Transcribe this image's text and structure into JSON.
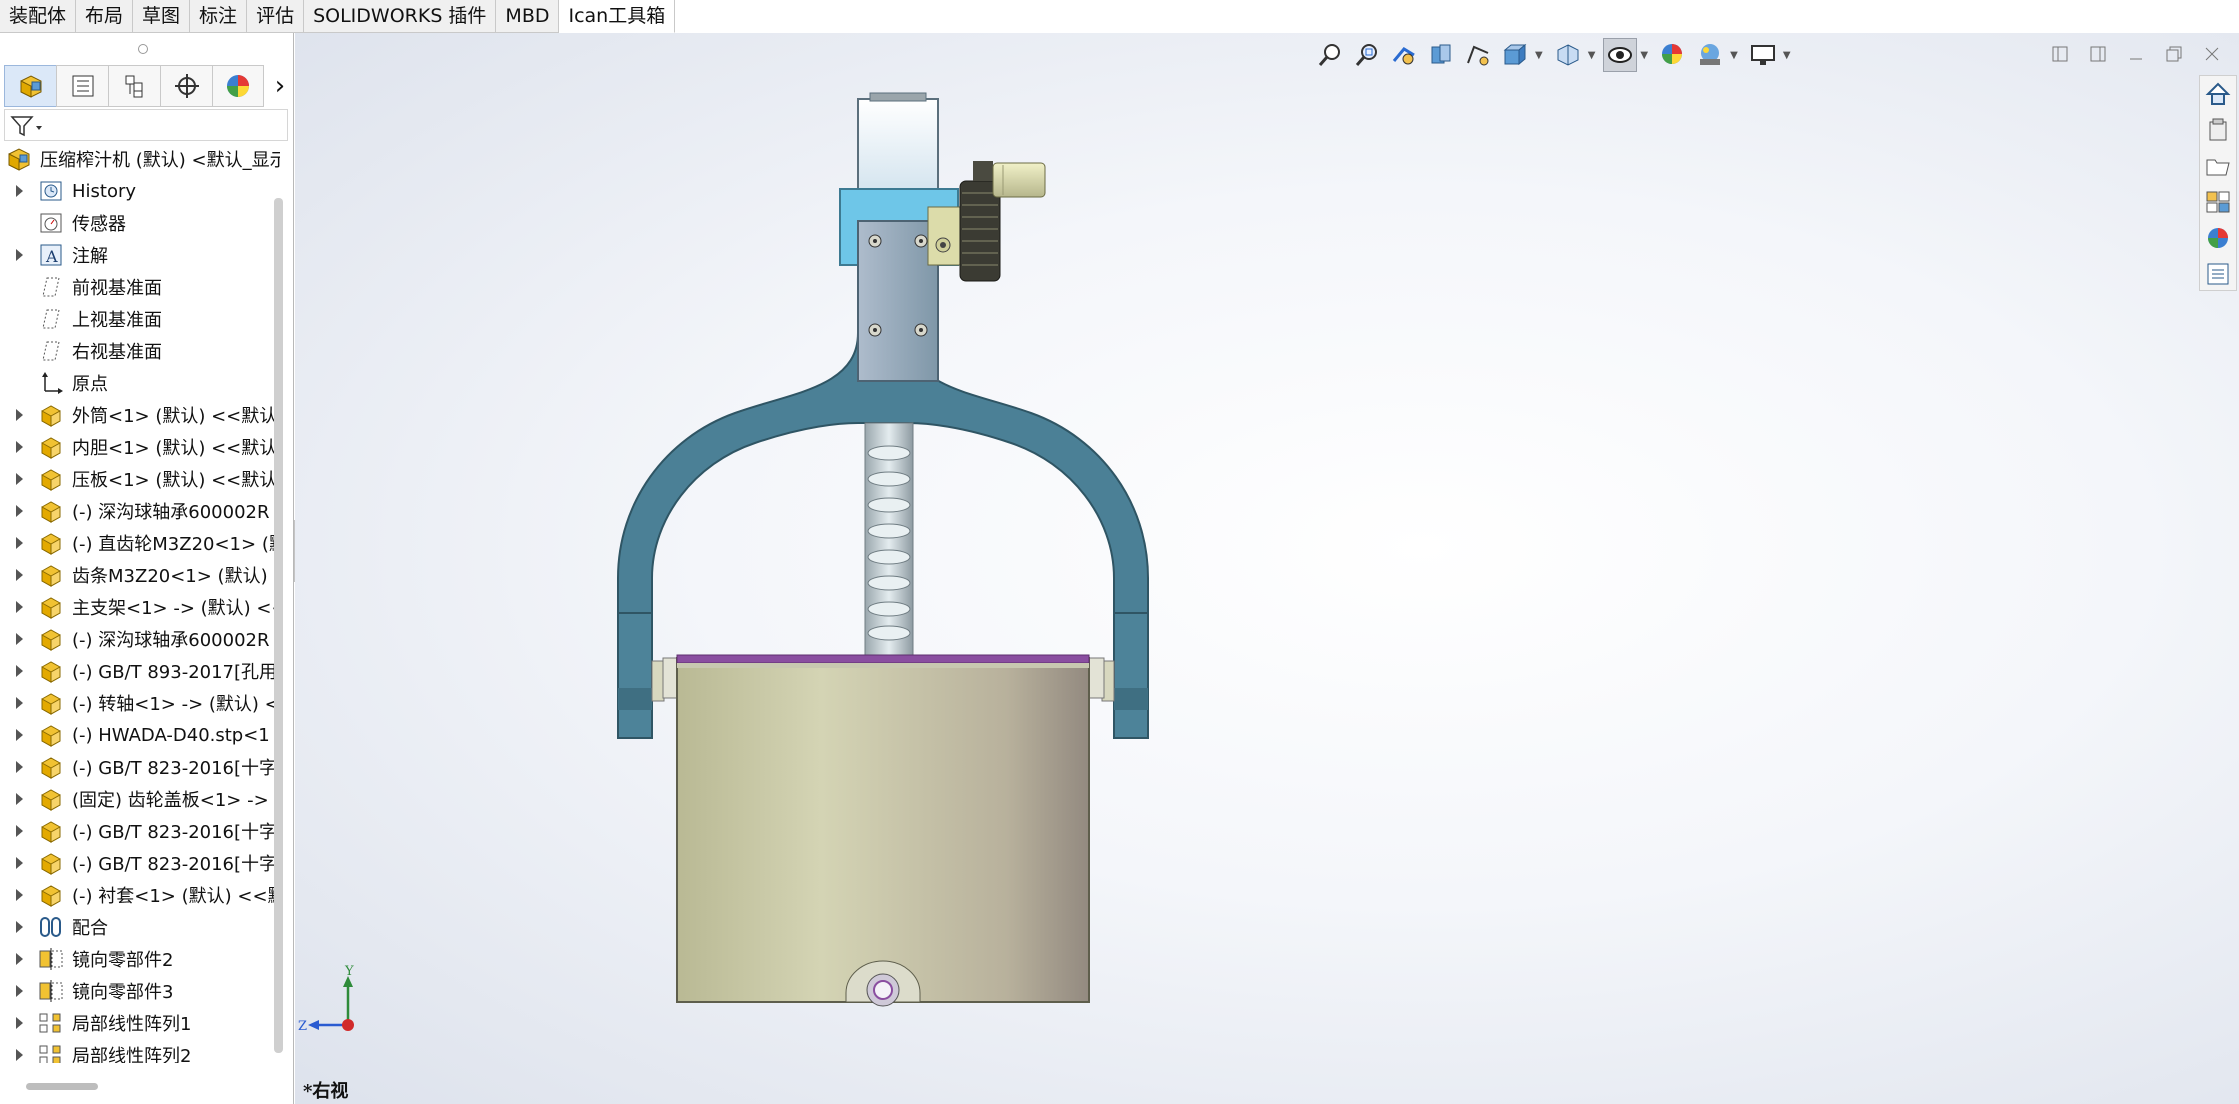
{
  "tabs": [
    {
      "label": "装配体",
      "active": false
    },
    {
      "label": "布局",
      "active": false
    },
    {
      "label": "草图",
      "active": false
    },
    {
      "label": "标注",
      "active": false
    },
    {
      "label": "评估",
      "active": false
    },
    {
      "label": "SOLIDWORKS 插件",
      "active": false
    },
    {
      "label": "MBD",
      "active": false
    },
    {
      "label": "Ican工具箱",
      "active": true
    }
  ],
  "panel_tabs": [
    {
      "name": "featuremanager-tab",
      "icon": "assembly-icon"
    },
    {
      "name": "propertymanager-tab",
      "icon": "property-list-icon"
    },
    {
      "name": "configurationmanager-tab",
      "icon": "configuration-icon"
    },
    {
      "name": "dimxpert-tab",
      "icon": "crosshair-icon"
    },
    {
      "name": "display-manager-tab",
      "icon": "appearance-sphere-icon"
    }
  ],
  "tree": {
    "root_label": "压缩榨汁机 (默认) <默认_显示",
    "items": [
      {
        "label": "History",
        "icon": "history-icon",
        "expandable": true
      },
      {
        "label": "传感器",
        "icon": "sensor-icon",
        "expandable": false
      },
      {
        "label": "注解",
        "icon": "annotation-icon",
        "expandable": true
      },
      {
        "label": "前视基准面",
        "icon": "plane-icon",
        "expandable": false
      },
      {
        "label": "上视基准面",
        "icon": "plane-icon",
        "expandable": false
      },
      {
        "label": "右视基准面",
        "icon": "plane-icon",
        "expandable": false
      },
      {
        "label": "原点",
        "icon": "origin-icon",
        "expandable": false
      },
      {
        "label": "外筒<1> (默认) <<默认",
        "icon": "part-icon",
        "expandable": true
      },
      {
        "label": "内胆<1> (默认) <<默认",
        "icon": "part-icon",
        "expandable": true
      },
      {
        "label": "压板<1> (默认) <<默认",
        "icon": "part-icon",
        "expandable": true
      },
      {
        "label": "(-) 深沟球轴承600002R",
        "icon": "part-icon",
        "expandable": true
      },
      {
        "label": "(-) 直齿轮M3Z20<1> (默",
        "icon": "part-icon",
        "expandable": true
      },
      {
        "label": "齿条M3Z20<1> (默认) <",
        "icon": "part-icon",
        "expandable": true
      },
      {
        "label": "主支架<1> -> (默认) <<",
        "icon": "part-icon",
        "expandable": true
      },
      {
        "label": "(-) 深沟球轴承600002R",
        "icon": "part-icon",
        "expandable": true
      },
      {
        "label": "(-) GB/T 893-2017[孔用",
        "icon": "part-icon",
        "expandable": true
      },
      {
        "label": "(-) 转轴<1> -> (默认) <",
        "icon": "part-icon",
        "expandable": true
      },
      {
        "label": "(-) HWADA-D40.stp<1",
        "icon": "part-icon",
        "expandable": true
      },
      {
        "label": "(-) GB/T 823-2016[十字",
        "icon": "part-icon",
        "expandable": true
      },
      {
        "label": "(固定) 齿轮盖板<1> ->",
        "icon": "part-icon",
        "expandable": true
      },
      {
        "label": "(-) GB/T 823-2016[十字",
        "icon": "part-icon",
        "expandable": true
      },
      {
        "label": "(-) GB/T 823-2016[十字",
        "icon": "part-icon",
        "expandable": true
      },
      {
        "label": "(-) 衬套<1> (默认) <<默",
        "icon": "part-icon",
        "expandable": true
      },
      {
        "label": "配合",
        "icon": "mates-icon",
        "expandable": true
      },
      {
        "label": "镜向零部件2",
        "icon": "mirror-component-icon",
        "expandable": true
      },
      {
        "label": "镜向零部件3",
        "icon": "mirror-component-icon",
        "expandable": true
      },
      {
        "label": "局部线性阵列1",
        "icon": "linear-pattern-icon",
        "expandable": true
      },
      {
        "label": "局部线性阵列2",
        "icon": "linear-pattern-icon",
        "expandable": true
      }
    ]
  },
  "view_toolbar": [
    "zoom-to-fit-icon",
    "zoom-to-area-icon",
    "previous-view-icon",
    "section-view-icon",
    "dynamic-annotation-icon",
    "view-orientation-icon",
    "display-style-icon",
    "hide-show-items-icon",
    "edit-appearance-icon",
    "apply-scene-icon",
    "view-settings-icon"
  ],
  "task_pane": [
    "solidworks-resources-icon",
    "design-library-icon",
    "file-explorer-icon",
    "view-palette-icon",
    "appearances-icon",
    "custom-properties-icon"
  ],
  "triad": {
    "x_label": "Z",
    "y_label": "Y"
  },
  "view_name": "*右视",
  "colors": {
    "frame": "#4b8096",
    "cylinder": "#c9c9a8",
    "bracket": "#8ba7b5",
    "gear": "#3b3b33",
    "accent_purple": "#8a4ea0"
  }
}
